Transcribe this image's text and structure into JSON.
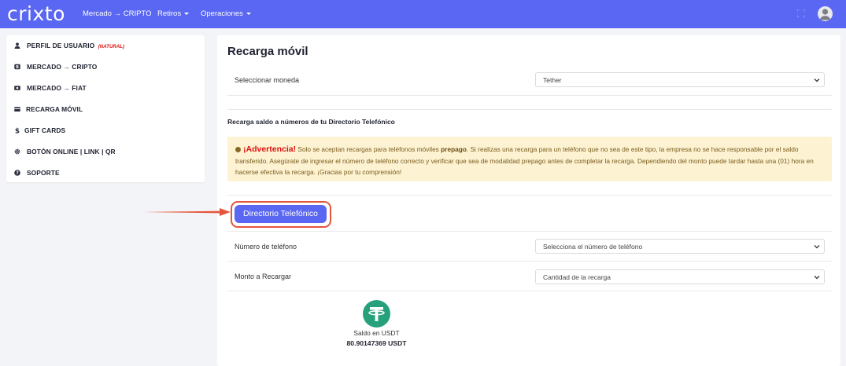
{
  "navbar": {
    "logo": "crixto",
    "items": [
      {
        "label": "Mercado → CRIPTO",
        "caret": false
      },
      {
        "label": "Retiros",
        "caret": true
      },
      {
        "label": "Operaciones",
        "caret": true
      }
    ],
    "icons": [
      "fullscreen-icon",
      "avatar-icon"
    ]
  },
  "sidebar": {
    "items": [
      {
        "label": "PERFIL DE USUARIO",
        "badge": "(NATURAL)",
        "icon": "user-icon"
      },
      {
        "label": "MERCADO → CRIPTO",
        "icon": "bitcoin-icon"
      },
      {
        "label": "MERCADO → FIAT",
        "icon": "money-icon"
      },
      {
        "label": "RECARGA MÓVIL",
        "icon": "card-icon"
      },
      {
        "label": "GIFT CARDS",
        "icon": "dollar-icon"
      },
      {
        "label": "BOTÓN ONLINE | LINK | QR",
        "icon": "gear-icon"
      },
      {
        "label": "SOPORTE",
        "icon": "question-icon"
      }
    ]
  },
  "main": {
    "title": "Recarga móvil",
    "currency": {
      "label": "Seleccionar moneda",
      "value": "Tether"
    },
    "section_title": "Recarga saldo a números de tu Directorio Telefónico",
    "alert": {
      "heading": "¡Advertencia!",
      "text_1": "Solo se aceptan recargas para teléfonos móviles",
      "bold": "prepago",
      "text_2": ". Si realizas una recarga para un teléfono que no sea de este tipo, la empresa no se hace responsable por el saldo transferido. Asegúrate de ingresar el número de teléfono correcto y verificar que sea de modalidad prepago antes de completar la recarga. Dependiendo del monto puede tardar hasta una (01) hora en hacerse efectiva la recarga. ¡Gracias por tu comprensión!"
    },
    "directory_button": "Directorio Telefónico",
    "phone": {
      "label": "Número de teléfono",
      "placeholder": "Selecciona el número de teléfono"
    },
    "amount": {
      "label": "Monto a Recargar",
      "placeholder": "Cantidad de la recarga"
    },
    "balance": {
      "label": "Saldo en USDT",
      "value": "80.90147369 USDT"
    }
  },
  "colors": {
    "primary": "#5a67f2",
    "highlight": "#e5553c",
    "warning_bg": "#fdf3d2",
    "tether": "#26a17b"
  }
}
